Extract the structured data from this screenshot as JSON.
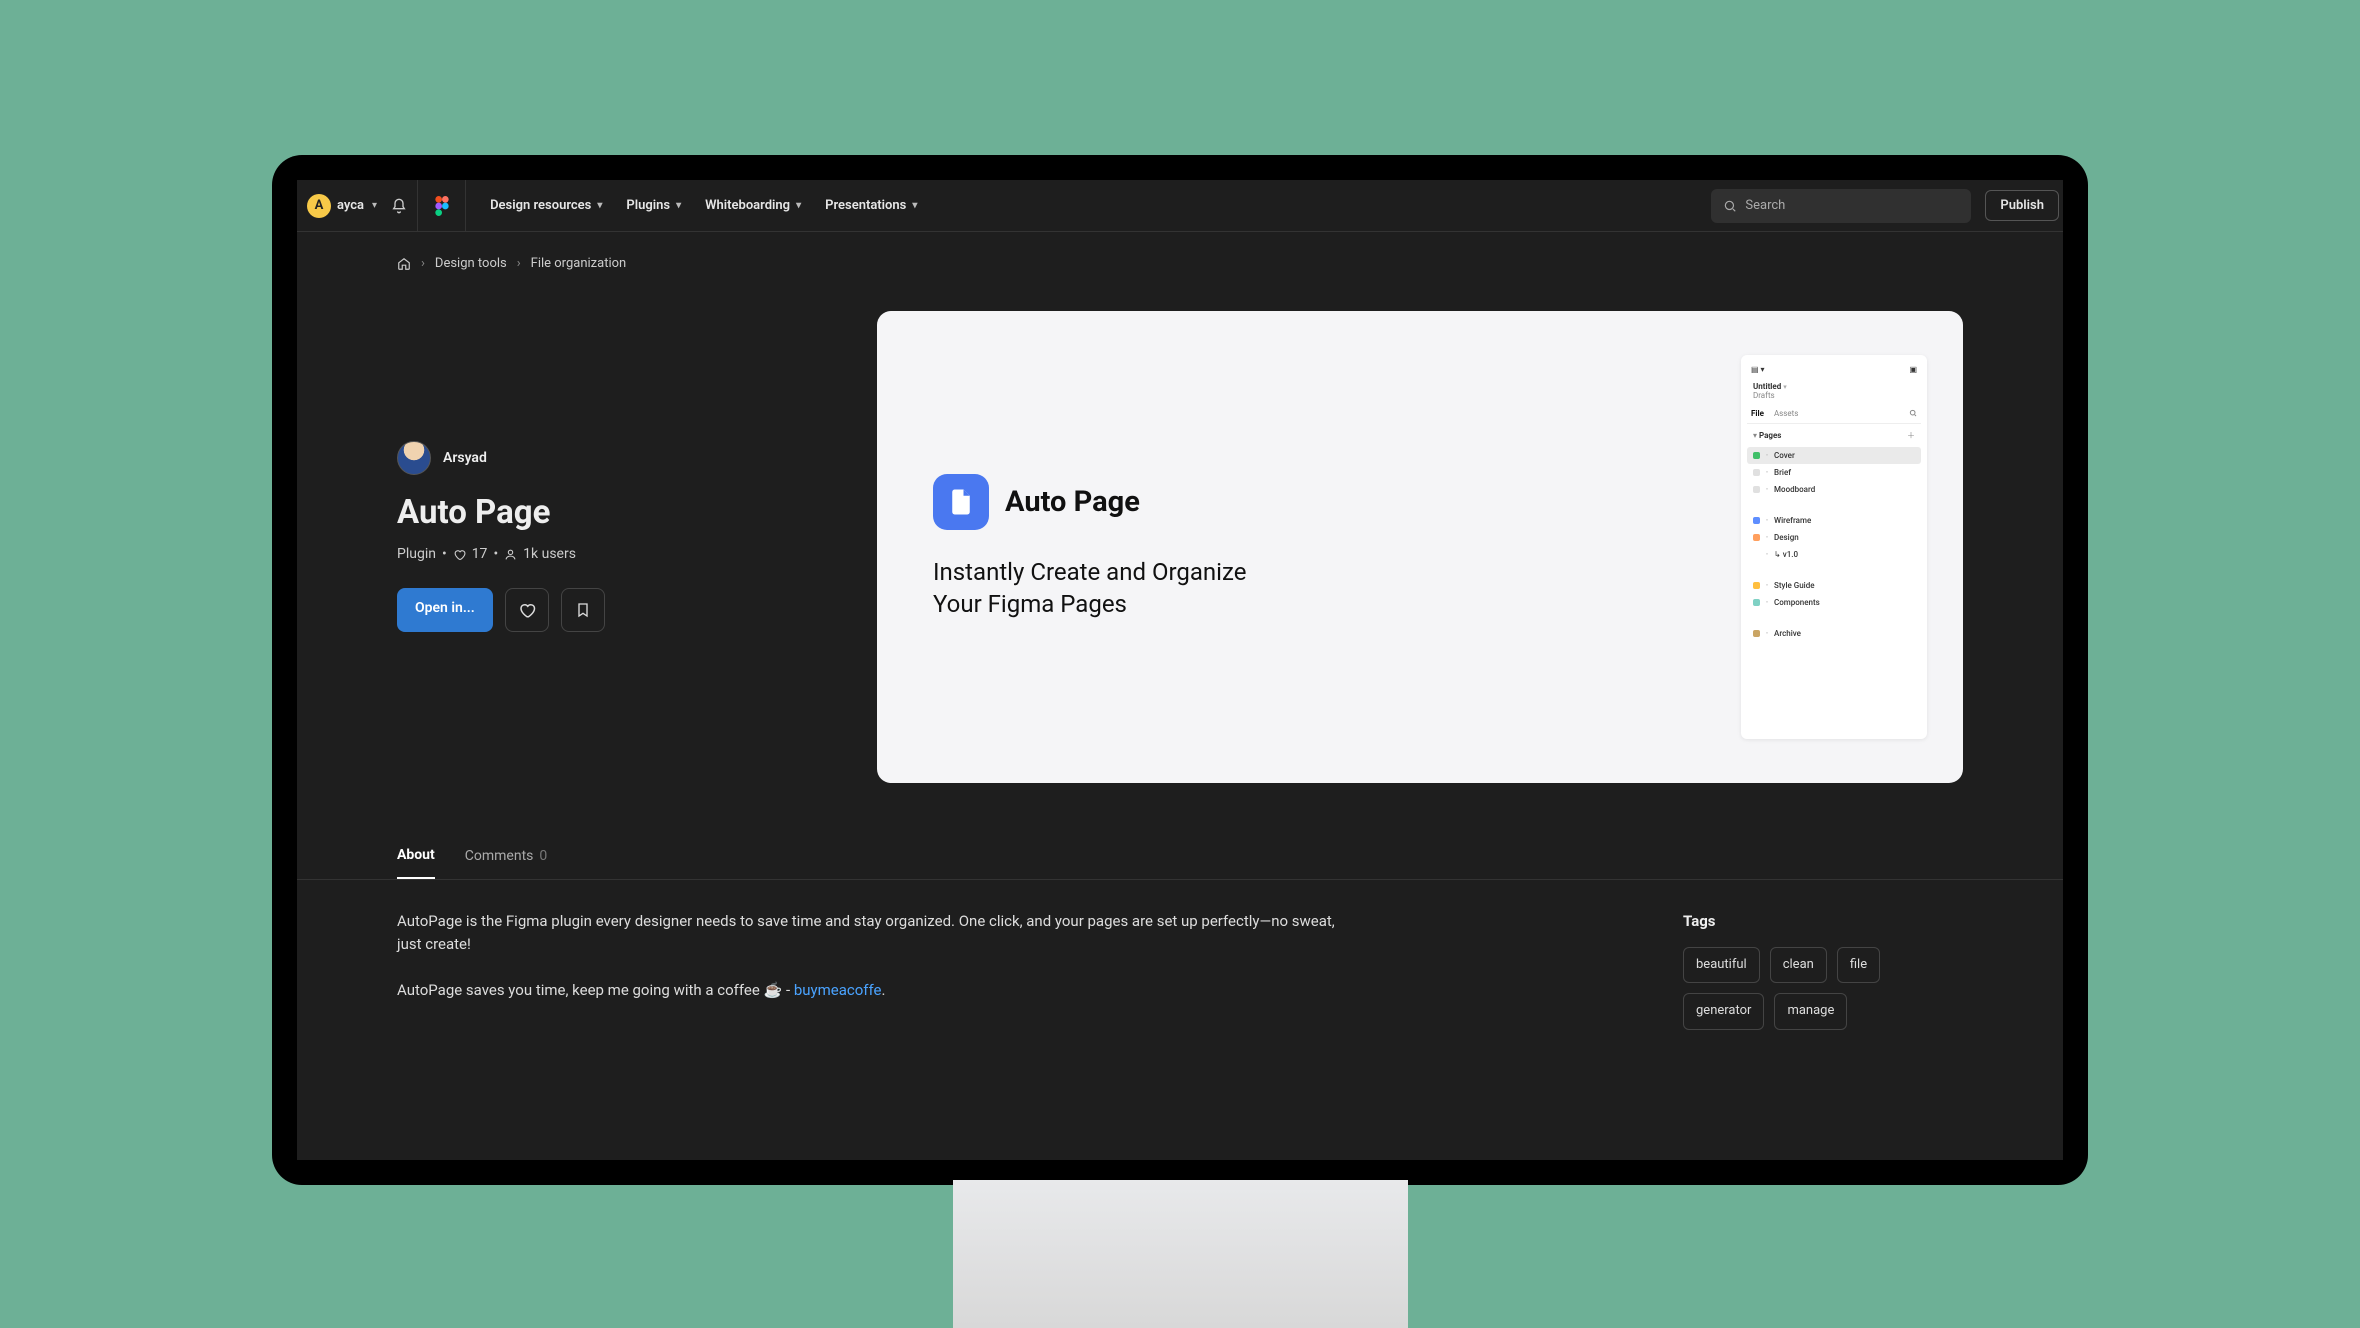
{
  "topbar": {
    "user": "ayca",
    "avatar_letter": "A",
    "nav": [
      "Design resources",
      "Plugins",
      "Whiteboarding",
      "Presentations"
    ],
    "search_placeholder": "Search",
    "publish": "Publish"
  },
  "breadcrumb": {
    "items": [
      "Design tools",
      "File organization"
    ]
  },
  "page": {
    "author": "Arsyad",
    "title": "Auto Page",
    "type": "Plugin",
    "likes": "17",
    "users": "1k users",
    "open": "Open in..."
  },
  "preview": {
    "logo_title": "Auto Page",
    "subtitle": "Instantly Create and Organize Your Figma Pages",
    "panel": {
      "file_title": "Untitled",
      "drafts": "Drafts",
      "tabs": [
        "File",
        "Assets"
      ],
      "pages_label": "Pages",
      "pages": [
        {
          "name": "Cover",
          "color": "#3fbf68",
          "selected": true
        },
        {
          "name": "Brief",
          "color": "#e0e0e0"
        },
        {
          "name": "Moodboard",
          "color": "#e0e0e0"
        },
        {
          "name": "Wireframe",
          "color": "#5e8eff"
        },
        {
          "name": "Design",
          "color": "#ff9f5e"
        },
        {
          "name": "↳ v1.0",
          "color": "transparent"
        },
        {
          "name": "Style Guide",
          "color": "#ffbf3f"
        },
        {
          "name": "Components",
          "color": "#7fd1c4"
        },
        {
          "name": "Archive",
          "color": "#caa564"
        }
      ]
    }
  },
  "tabs": {
    "about": "About",
    "comments": "Comments",
    "comments_count": "0"
  },
  "about": {
    "p1": "AutoPage is the Figma plugin every designer needs to save time and stay organized. One click, and your pages are set up perfectly—no sweat, just create!",
    "p2a": "AutoPage saves you time, keep me going with a coffee ☕ - ",
    "p2b_link": "buymeacoffe",
    "p2c": "."
  },
  "sidebar": {
    "tags_label": "Tags",
    "tags": [
      "beautiful",
      "clean",
      "file",
      "generator",
      "manage"
    ]
  }
}
